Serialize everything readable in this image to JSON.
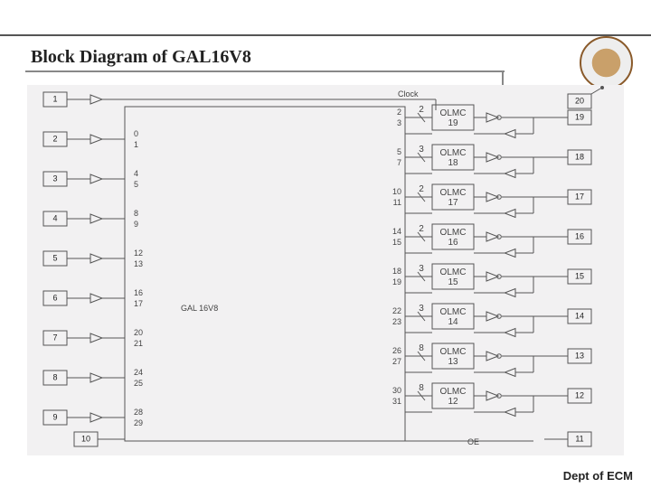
{
  "title": "Block Diagram of GAL16V8",
  "footer": "Dept of ECM",
  "diagram": {
    "chip_label": "GAL 16V8",
    "clock_label": "Clock",
    "oe_label": "OE",
    "left_pins": [
      "1",
      "2",
      "3",
      "4",
      "5",
      "6",
      "7",
      "8",
      "9",
      "10"
    ],
    "right_pins": [
      "20",
      "19",
      "18",
      "17",
      "16",
      "15",
      "14",
      "13",
      "12",
      "11"
    ],
    "olmc_names": [
      "OLMC 19",
      "OLMC 18",
      "OLMC 17",
      "OLMC 16",
      "OLMC 15",
      "OLMC 14",
      "OLMC 13",
      "OLMC 12"
    ],
    "product_term_counts": [
      "2",
      "3",
      "2",
      "2",
      "3",
      "3",
      "8",
      "8"
    ],
    "and_outputs": [
      [
        "2",
        "3"
      ],
      [
        "5",
        "7"
      ],
      [
        "10",
        "11"
      ],
      [
        "14",
        "15"
      ],
      [
        "18",
        "19"
      ],
      [
        "22",
        "23"
      ],
      [
        "26",
        "27"
      ],
      [
        "30",
        "31"
      ]
    ],
    "input_cols": [
      [
        "0",
        "1"
      ],
      [
        "4",
        "5"
      ],
      [
        "8",
        "9"
      ],
      [
        "12",
        "13"
      ],
      [
        "16",
        "17"
      ],
      [
        "20",
        "21"
      ],
      [
        "24",
        "25"
      ],
      [
        "28",
        "29"
      ]
    ]
  }
}
